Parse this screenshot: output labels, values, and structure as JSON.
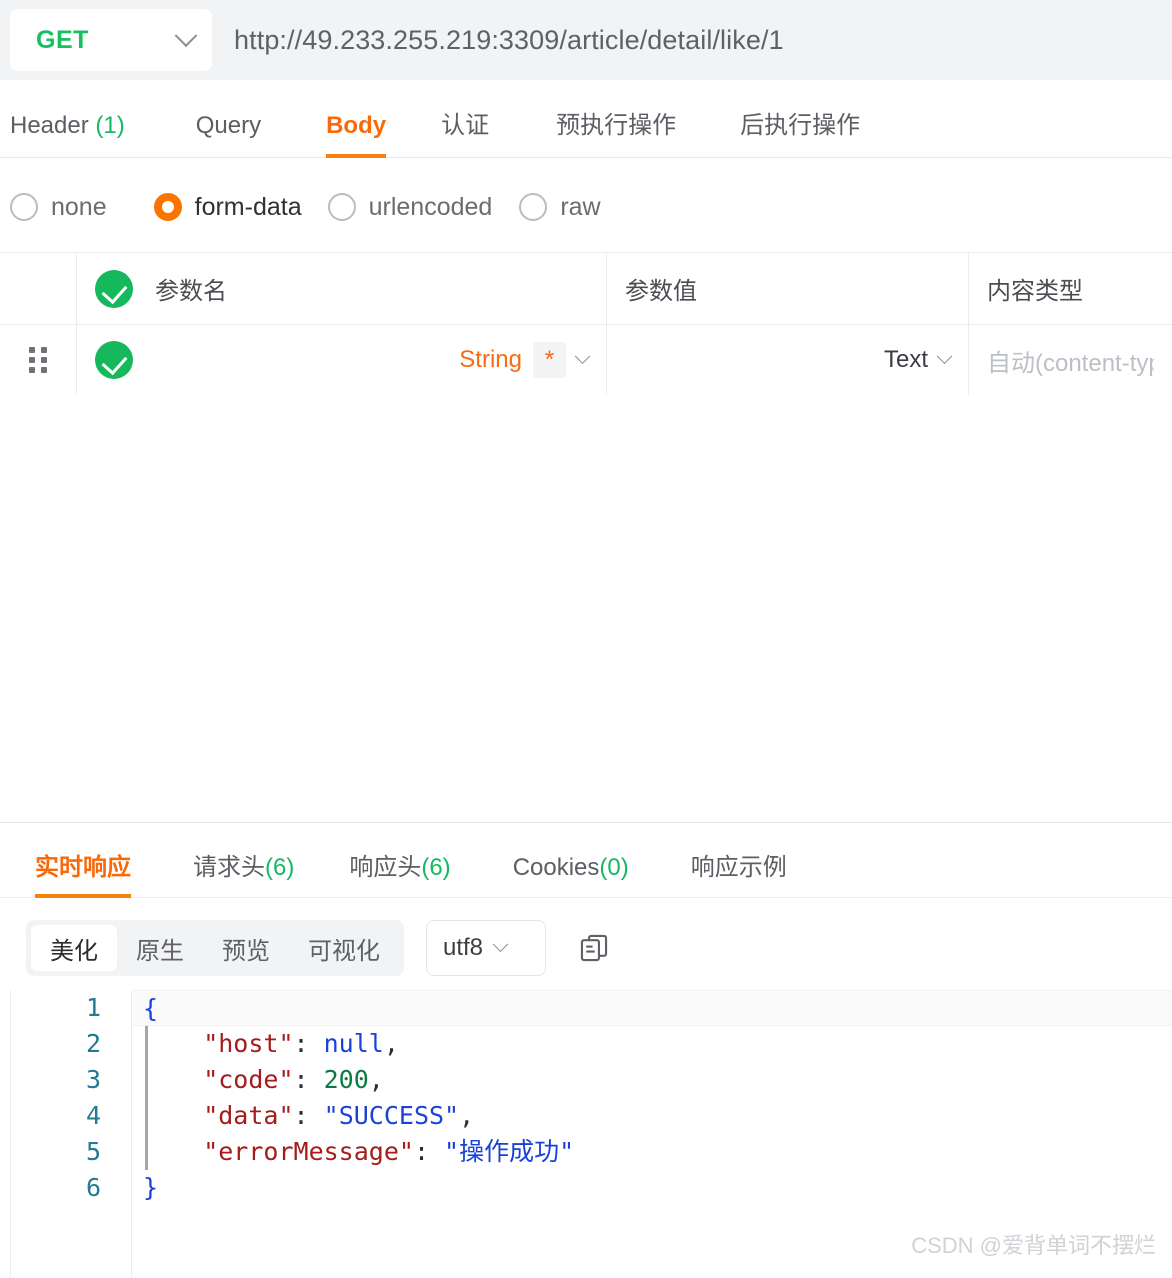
{
  "request": {
    "method": "GET",
    "url": "http://49.233.255.219:3309/article/detail/like/1",
    "tabs": [
      {
        "label": "Header ",
        "count": "(1)",
        "active": false
      },
      {
        "label": "Query",
        "count": "",
        "active": false
      },
      {
        "label": "Body",
        "count": "",
        "active": true
      },
      {
        "label": "认证",
        "count": "",
        "active": false
      },
      {
        "label": "预执行操作",
        "count": "",
        "active": false
      },
      {
        "label": "后执行操作",
        "count": "",
        "active": false
      }
    ],
    "body_types": [
      {
        "label": "none",
        "selected": false
      },
      {
        "label": "form-data",
        "selected": true
      },
      {
        "label": "urlencoded",
        "selected": false
      },
      {
        "label": "raw",
        "selected": false
      }
    ],
    "table": {
      "headers": {
        "param_name": "参数名",
        "param_value": "参数值",
        "content_type": "内容类型"
      },
      "rows": [
        {
          "enabled": true,
          "name": "",
          "name_type": "String",
          "required_badge": "*",
          "value": "",
          "value_type": "Text",
          "content_type_placeholder": "自动(content-typ"
        }
      ]
    }
  },
  "response": {
    "tabs": [
      {
        "label": "实时响应",
        "count": "",
        "active": true
      },
      {
        "label": "请求头",
        "count": "(6)",
        "active": false
      },
      {
        "label": "响应头",
        "count": "(6)",
        "active": false
      },
      {
        "label": "Cookies",
        "count": "(0)",
        "active": false
      },
      {
        "label": "响应示例",
        "count": "",
        "active": false
      }
    ],
    "format_modes": [
      {
        "label": "美化",
        "active": true
      },
      {
        "label": "原生",
        "active": false
      },
      {
        "label": "预览",
        "active": false
      },
      {
        "label": "可视化",
        "active": false
      }
    ],
    "encoding": "utf8",
    "code_lines": [
      {
        "num": "1",
        "text": "{"
      },
      {
        "num": "2",
        "text": "    \"host\": null,"
      },
      {
        "num": "3",
        "text": "    \"code\": 200,"
      },
      {
        "num": "4",
        "text": "    \"data\": \"SUCCESS\","
      },
      {
        "num": "5",
        "text": "    \"errorMessage\": \"操作成功\""
      },
      {
        "num": "6",
        "text": "}"
      }
    ],
    "body": {
      "host": "null",
      "code": "200",
      "data": "SUCCESS",
      "errorMessage": "操作成功"
    }
  },
  "watermark": "CSDN @爱背单词不摆烂",
  "colors": {
    "accent_orange": "#f7820a",
    "method_green": "#16c060",
    "check_green": "#16b85c",
    "count_green": "#17b862",
    "type_orange": "#fa6a10"
  }
}
